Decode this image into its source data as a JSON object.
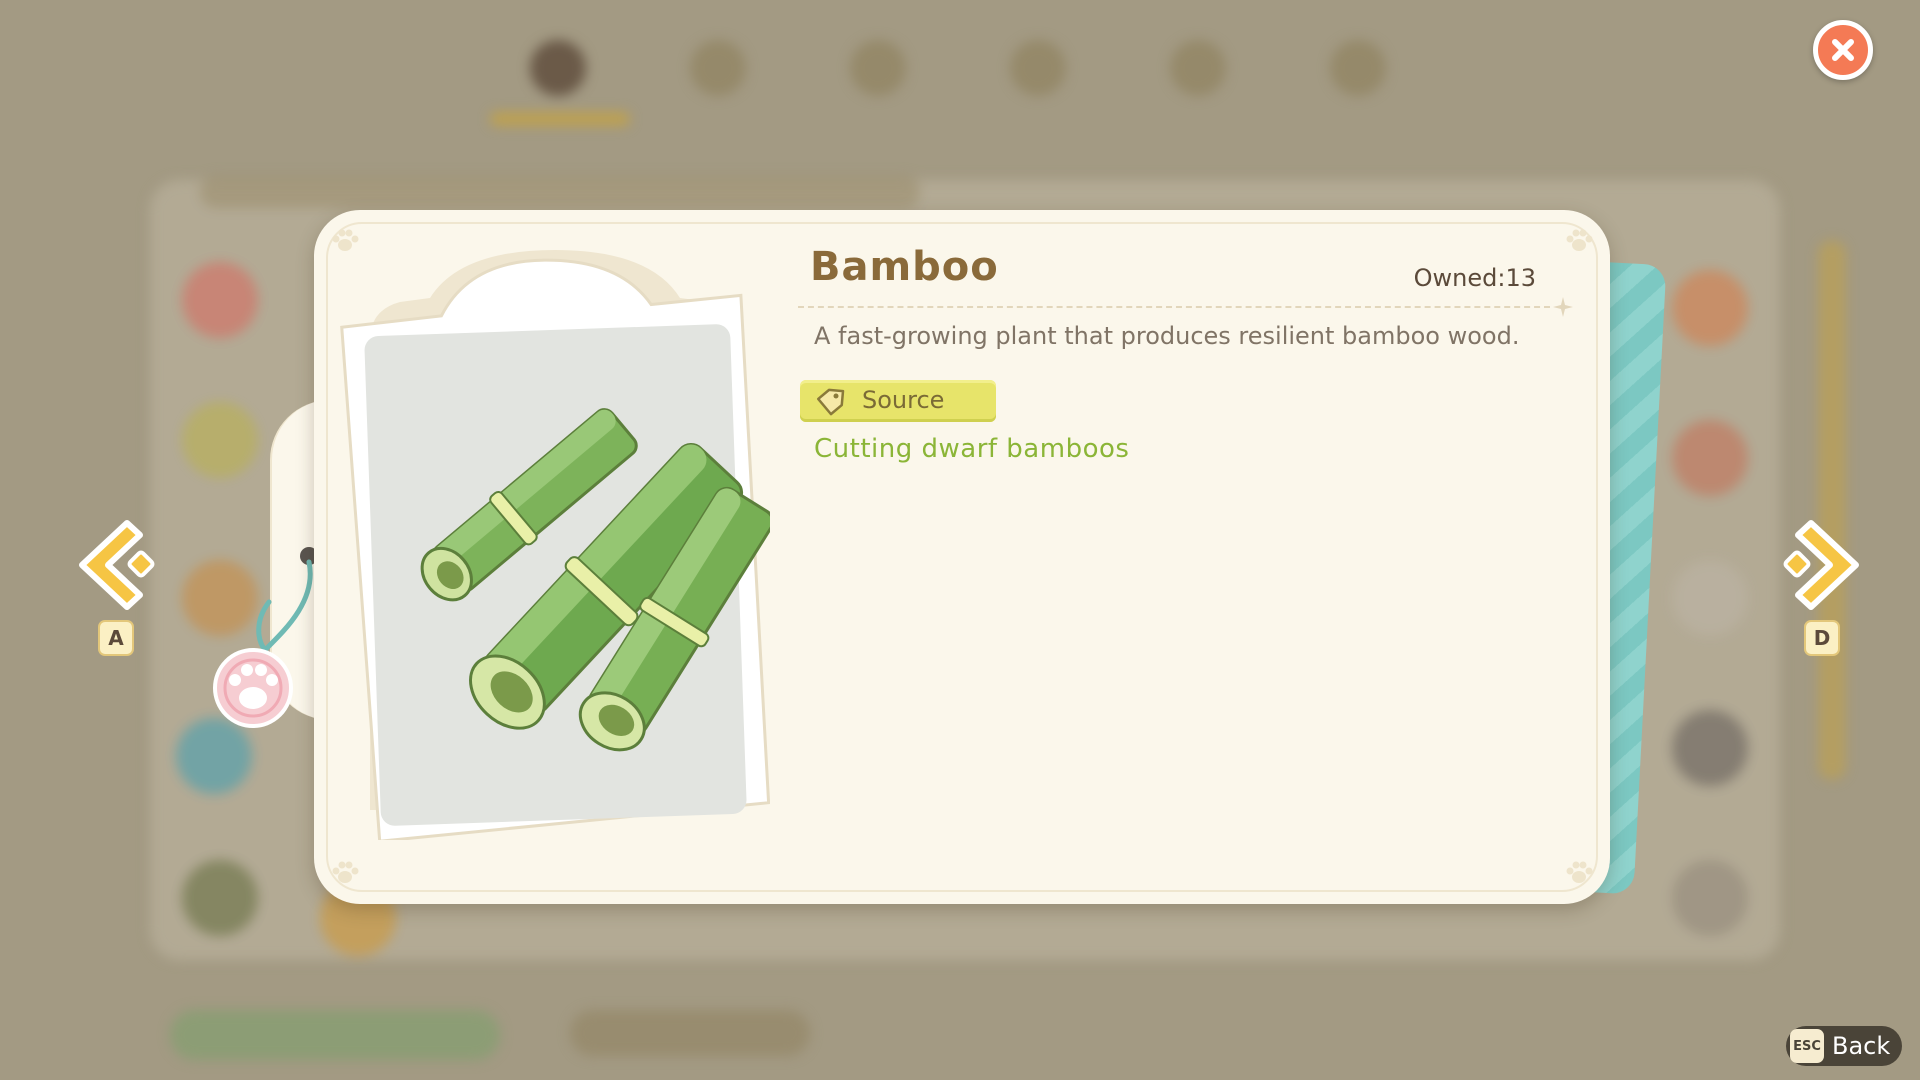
{
  "item": {
    "name": "Bamboo",
    "owned": "Owned:13",
    "description": "A fast-growing plant that produces resilient bamboo wood.",
    "source_label": "Source",
    "source_text": "Cutting dwarf bamboos",
    "icon": "bamboo-icon"
  },
  "navigation": {
    "prev_key": "A",
    "next_key": "D"
  },
  "footer": {
    "esc_key": "ESC",
    "back_label": "Back"
  },
  "colors": {
    "accent_title": "#8a6a3a",
    "source_green": "#8bb537",
    "source_tag": "#e7e46a",
    "close_button": "#f47a55",
    "nav_arrow": "#f6c544"
  }
}
